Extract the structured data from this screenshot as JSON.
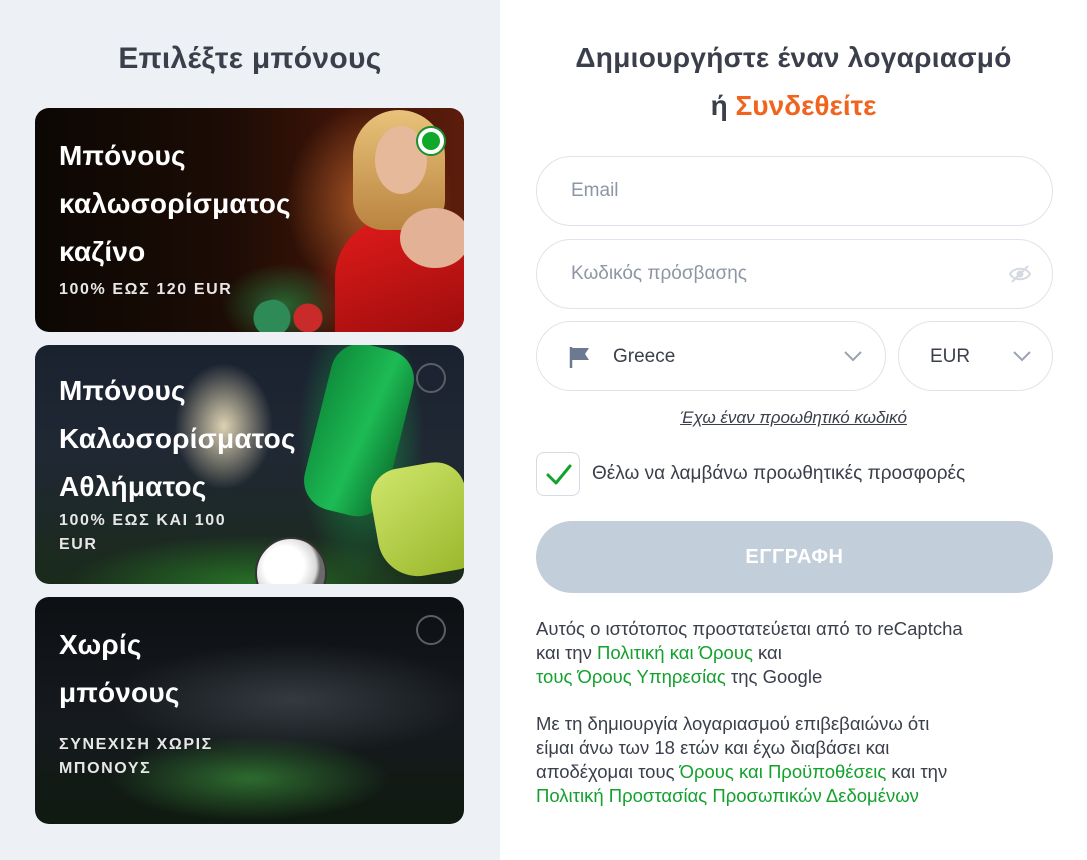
{
  "left": {
    "title": "Επιλέξτε μπόνους",
    "cards": [
      {
        "title_lines": [
          "Μπόνους",
          "καλωσορίσματος",
          "καζίνο"
        ],
        "subtitle_lines": [
          "100% ΕΩΣ 120 EUR"
        ],
        "selected": true
      },
      {
        "title_lines": [
          "Μπόνους",
          "Καλωσορίσματος",
          "Αθλήματος"
        ],
        "subtitle_lines": [
          "100% ΕΩΣ ΚΑΙ 100",
          "EUR"
        ],
        "selected": false
      },
      {
        "title_lines": [
          "Χωρίς",
          "μπόνους"
        ],
        "subtitle_lines": [
          "ΣΥΝΕΧΙΣΗ ΧΩΡΙΣ",
          "ΜΠΟΝΟΥΣ"
        ],
        "selected": false
      }
    ]
  },
  "right": {
    "heading_line1": "Δημιουργήστε έναν λογαριασμό",
    "heading_or": "ή",
    "heading_login": "Συνδεθείτε",
    "email_placeholder": "Email",
    "password_placeholder": "Κωδικός πρόσβασης",
    "country_value": "Greece",
    "currency_value": "EUR",
    "promo_link": "Έχω έναν προωθητικό κωδικό",
    "offers_checkbox_label": "Θέλω να λαμβάνω προωθητικές προσφορές",
    "offers_checked": true,
    "register_label": "ΕΓΓΡΑΦΗ",
    "legal1": {
      "t1": "Αυτός ο ιστότοπος προστατεύεται από το reCaptcha",
      "t2": "και την ",
      "link1": "Πολιτική και Όρους",
      "t3": " και",
      "link2": "τους Όρους Υπηρεσίας",
      "t4": " της Google"
    },
    "legal2": {
      "t1": "Με τη δημιουργία λογαριασμού επιβεβαιώνω ότι",
      "t2": "είμαι άνω των 18 ετών και έχω διαβάσει και",
      "t3": "αποδέχομαι τους ",
      "link1": "Όρους και Προϋποθέσεις",
      "t4": " και την",
      "link2": "Πολιτική Προστασίας Προσωπικών Δεδομένων"
    }
  },
  "colors": {
    "accent_orange": "#f0641e",
    "link_green": "#14a12e",
    "radio_green": "#0fa829",
    "register_disabled": "#c3cedb",
    "text_dark": "#3a3f4b",
    "left_bg": "#edf0f5"
  },
  "icons": {
    "radio_selected": "radio-selected-icon",
    "flag": "flag-icon",
    "chevron": "chevron-down-icon",
    "eye": "eye-slash-icon",
    "check": "checkmark-icon"
  }
}
